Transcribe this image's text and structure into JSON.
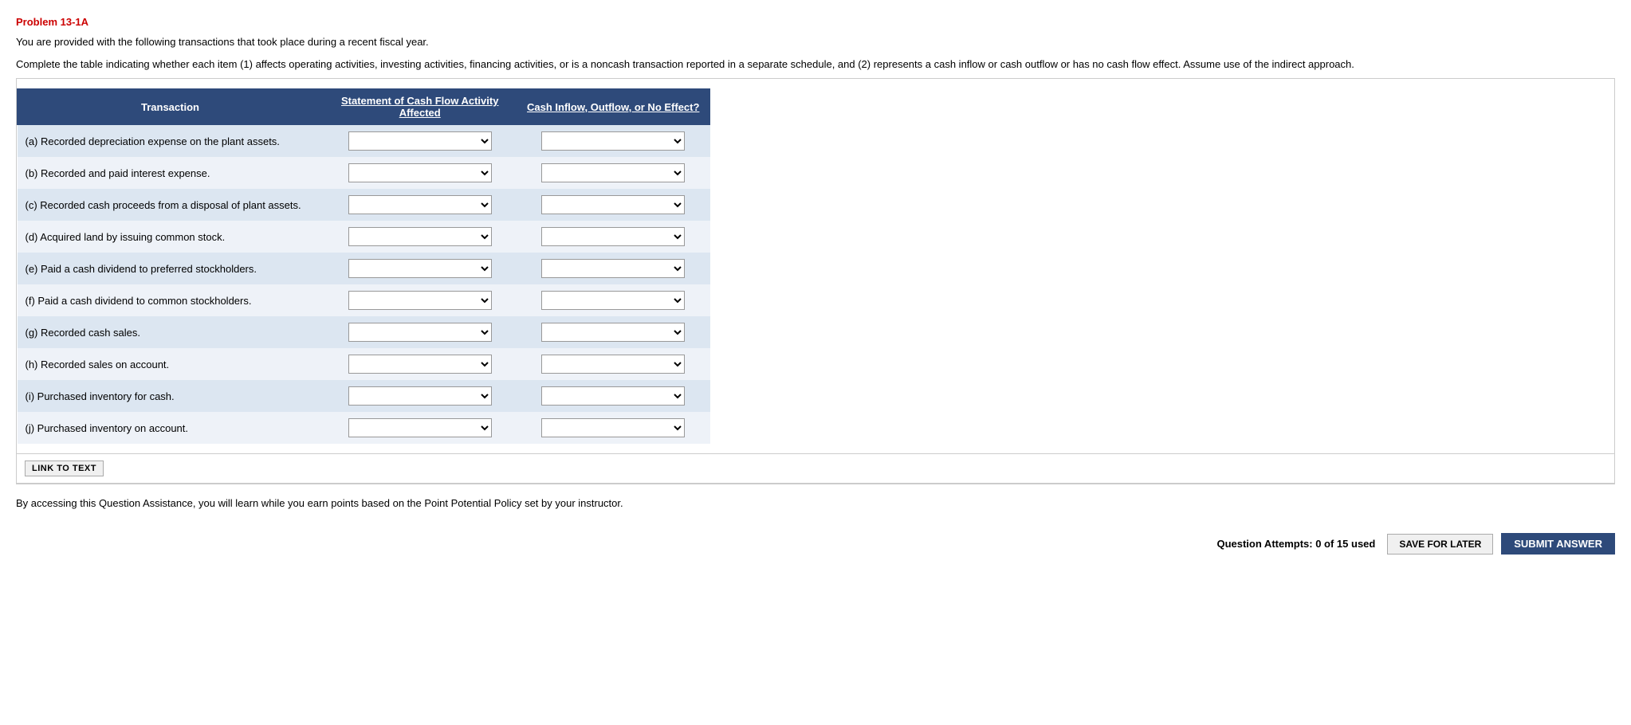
{
  "problem": {
    "title": "Problem 13-1A",
    "intro1": "You are provided with the following transactions that took place during a recent fiscal year.",
    "intro2": "Complete the table indicating whether each item (1) affects operating activities, investing activities, financing activities, or is a noncash transaction reported in a separate schedule, and (2) represents a cash inflow or cash outflow or has no cash flow effect. Assume use of the indirect approach.",
    "table": {
      "col1_header": "Transaction",
      "col2_header": "Statement of Cash Flow Activity Affected",
      "col3_header": "Cash Inflow, Outflow, or No Effect?",
      "rows": [
        {
          "label": "(a)",
          "transaction": "Recorded depreciation expense on the plant assets."
        },
        {
          "label": "(b)",
          "transaction": "Recorded and paid interest expense."
        },
        {
          "label": "(c)",
          "transaction": "Recorded cash proceeds from a disposal of plant assets."
        },
        {
          "label": "(d)",
          "transaction": "Acquired land by issuing common stock."
        },
        {
          "label": "(e)",
          "transaction": "Paid a cash dividend to preferred stockholders."
        },
        {
          "label": "(f)",
          "transaction": "Paid a cash dividend to common stockholders."
        },
        {
          "label": "(g)",
          "transaction": "Recorded cash sales."
        },
        {
          "label": "(h)",
          "transaction": "Recorded sales on account."
        },
        {
          "label": "(i)",
          "transaction": "Purchased inventory for cash."
        },
        {
          "label": "(j)",
          "transaction": "Purchased inventory on account."
        }
      ]
    },
    "link_to_text_label": "LINK TO TEXT",
    "bottom_note": "By accessing this Question Assistance, you will learn while you earn points based on the Point Potential Policy set by your instructor.",
    "attempts_text": "Question Attempts: 0 of 15 used",
    "save_label": "SAVE FOR LATER",
    "submit_label": "SUBMIT ANSWER"
  }
}
